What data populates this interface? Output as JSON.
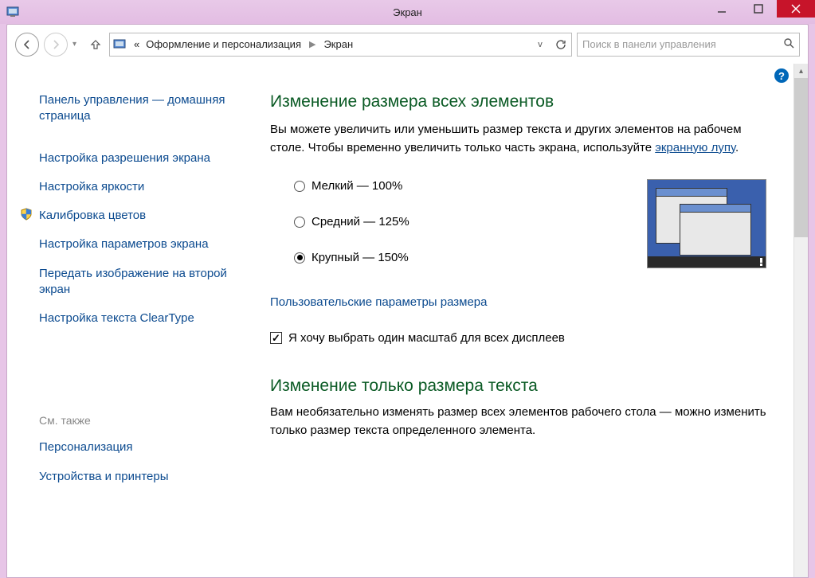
{
  "titlebar": {
    "title": "Экран"
  },
  "nav": {
    "breadcrumb_prefix": "«",
    "crumb1": "Оформление и персонализация",
    "crumb2": "Экран"
  },
  "search": {
    "placeholder": "Поиск в панели управления"
  },
  "sidebar": {
    "home": "Панель управления — домашняя страница",
    "items": [
      "Настройка разрешения экрана",
      "Настройка яркости",
      "Калибровка цветов",
      "Настройка параметров экрана",
      "Передать изображение на второй экран",
      "Настройка текста ClearType"
    ],
    "also_header": "См. также",
    "also_items": [
      "Персонализация",
      "Устройства и принтеры"
    ]
  },
  "main": {
    "title1": "Изменение размера всех элементов",
    "desc1_a": "Вы можете увеличить или уменьшить размер текста и других элементов на рабочем столе. Чтобы временно увеличить только часть экрана, используйте ",
    "desc1_link": "экранную лупу",
    "desc1_b": ".",
    "radio1": "Мелкий — 100%",
    "radio2": "Средний — 125%",
    "radio3": "Крупный — 150%",
    "custom_link": "Пользовательские параметры размера",
    "checkbox_label": "Я хочу выбрать один масштаб для всех дисплеев",
    "title2": "Изменение только размера текста",
    "desc2": "Вам необязательно изменять размер всех элементов рабочего стола — можно изменить только размер текста определенного элемента."
  }
}
